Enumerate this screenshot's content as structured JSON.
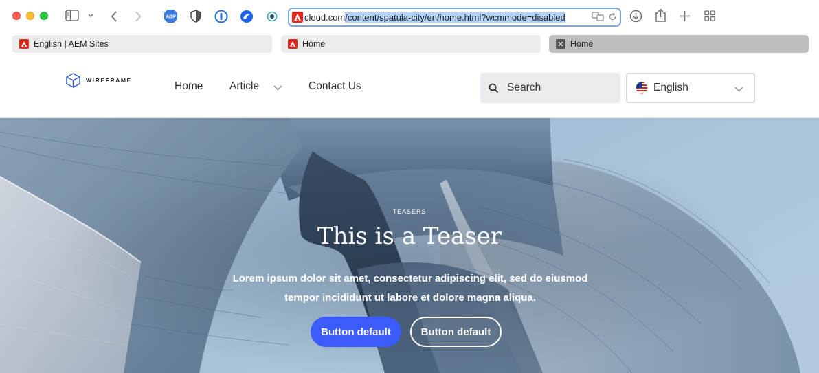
{
  "browser": {
    "url_prefix": "cloud.com",
    "url_selected": "/content/spatula-city/en/home.html?wcmmode=disabled",
    "tabs": [
      {
        "label": "English | AEM Sites"
      },
      {
        "label": "Home"
      },
      {
        "label": "Home"
      }
    ],
    "extensions": [
      {
        "name": "adblock-icon",
        "label": "ABP"
      }
    ]
  },
  "site": {
    "logo_text": "WIREFRAME",
    "nav": [
      {
        "label": "Home"
      },
      {
        "label": "Article"
      },
      {
        "label": "Contact Us"
      }
    ],
    "search": {
      "placeholder": "Search"
    },
    "language": {
      "selected": "English"
    }
  },
  "hero": {
    "pretitle": "TEASERS",
    "title": "This is a Teaser",
    "description": "Lorem ipsum dolor sit amet, consectetur adipiscing elit, sed do eiusmod tempor incididunt ut labore et dolore magna aliqua.",
    "buttons": [
      {
        "label": "Button default"
      },
      {
        "label": "Button default"
      }
    ]
  },
  "colors": {
    "primary_button": "#3b5bfd",
    "adobe_red": "#e1251b",
    "url_focus": "#7aa6e8"
  }
}
